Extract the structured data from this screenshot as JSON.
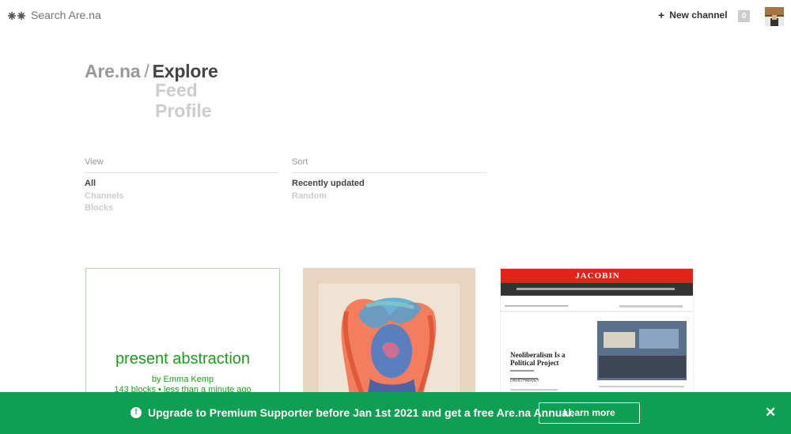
{
  "header": {
    "search_placeholder": "Search Are.na",
    "new_channel_label": "New channel",
    "notification_count": "0"
  },
  "nav": {
    "root": "Are.na",
    "separator": "/",
    "current": "Explore",
    "items": [
      "Feed",
      "Profile"
    ]
  },
  "filters": {
    "view": {
      "title": "View",
      "options": [
        "All",
        "Channels",
        "Blocks"
      ],
      "selected": "All"
    },
    "sort": {
      "title": "Sort",
      "options": [
        "Recently updated",
        "Random"
      ],
      "selected": "Recently updated"
    }
  },
  "cards": {
    "channel": {
      "title": "present abstraction",
      "by": "by Emma Kemp",
      "meta": "143 blocks • less than a minute ago"
    },
    "jacobin": {
      "masthead": "JACOBIN",
      "headline": "Neoliberalism Is a Political Project",
      "byline": "DAVID HARVEY"
    }
  },
  "banner": {
    "text": "Upgrade to Premium Supporter before Jan 1st 2021 and get a free Are.na Annual.",
    "button": "Learn more",
    "color": "#0f9f52"
  }
}
